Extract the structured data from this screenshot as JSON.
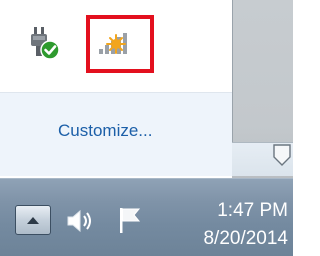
{
  "flyout": {
    "icons": [
      {
        "name": "power-plugged-icon"
      },
      {
        "name": "network-signal-icon"
      }
    ],
    "customize_label": "Customize..."
  },
  "taskbar": {
    "time": "1:47 PM",
    "date": "8/20/2014",
    "icons": [
      "show-hidden-icons-arrow",
      "volume-speaker-icon",
      "action-center-flag-icon"
    ]
  },
  "colors": {
    "highlight": "#e3101e",
    "link": "#1c5fa8",
    "taskbar": "#7f93a8",
    "clock_text": "#ffffff"
  }
}
